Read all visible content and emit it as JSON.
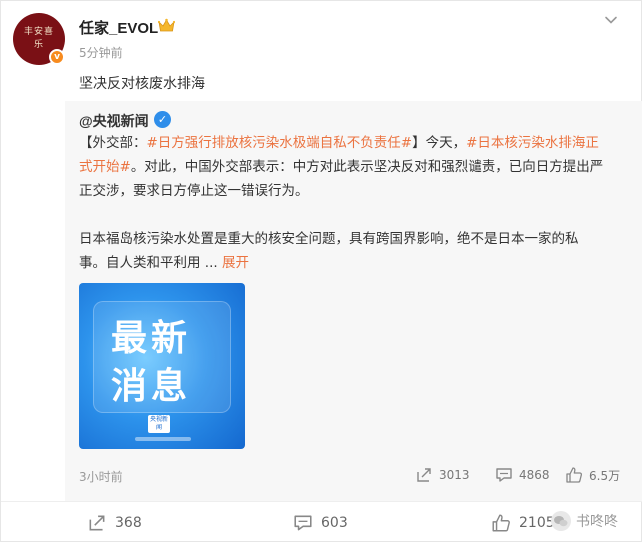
{
  "post": {
    "username": "任家_EVOL",
    "time": "5分钟前",
    "text": "坚决反对核废水排海",
    "avatar_text": "丰安喜乐"
  },
  "repost": {
    "author": "@央视新闻",
    "p1_l1_a": "【外交部：",
    "p1_l1_tag": "#日方强行排放核污染水极端自私不负责任#",
    "p1_l1_b": "】今天，",
    "p1_l1_tag2": "#日本核污染水排海正",
    "p1_l2_tag": "式开始#",
    "p1_l2_b": "。对此，中国外交部表示：中方对此表示坚决反对和强烈谴责，已向日方提出严",
    "p1_l3": "正交涉，要求日方停止这一错误行为。",
    "p2_l1": "日本福岛核污染水处置是重大的核安全问题，具有跨国界影响，绝不是日本一家的私",
    "p2_l2": "事。自人类和平利用 ... ",
    "expand": "展开",
    "image_line1": "最新",
    "image_line2": "消息",
    "image_logo": "央视新闻",
    "time": "3小时前",
    "reposts": "3013",
    "comments": "4868",
    "likes": "6.5万"
  },
  "bottom": {
    "reposts": "368",
    "comments": "603",
    "likes": "2105",
    "watermark": "书咚咚"
  },
  "colors": {
    "hashtag": "#eb7340",
    "verify_blue": "#2f8eea",
    "badge_orange": "#f78b1f",
    "avatar_red": "#7a1015"
  }
}
